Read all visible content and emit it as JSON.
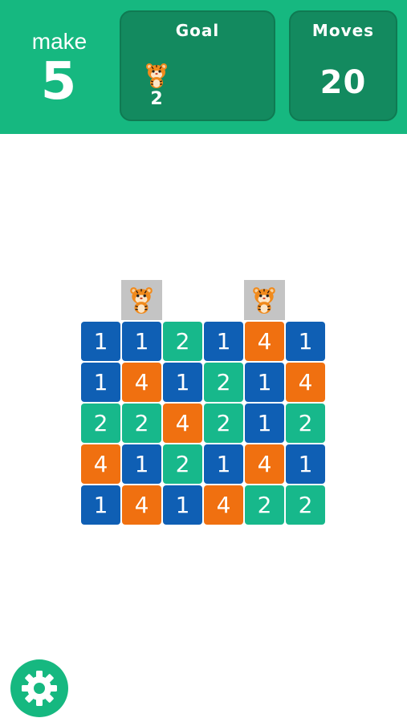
{
  "header": {
    "make_label": "make",
    "make_value": "5",
    "goal_title": "Goal",
    "goal_icon": "tiger-icon",
    "goal_count": "2",
    "moves_title": "Moves",
    "moves_value": "20"
  },
  "board": {
    "targets": [
      {
        "column": 1,
        "icon": "tiger-icon"
      },
      {
        "column": 4,
        "icon": "tiger-icon"
      }
    ],
    "rows": [
      [
        1,
        1,
        2,
        1,
        4,
        1
      ],
      [
        1,
        4,
        1,
        2,
        1,
        4
      ],
      [
        2,
        2,
        4,
        2,
        1,
        2
      ],
      [
        4,
        1,
        2,
        1,
        4,
        1
      ],
      [
        1,
        4,
        1,
        4,
        2,
        2
      ]
    ],
    "tile_colors": {
      "1": "#0f5fb4",
      "2": "#17b88b",
      "4": "#f07010"
    }
  },
  "footer": {
    "settings_icon": "gear-icon"
  },
  "colors": {
    "header_bg": "#16b880",
    "panel_bg": "#138a5f",
    "target_bg": "#c4c4c4"
  }
}
